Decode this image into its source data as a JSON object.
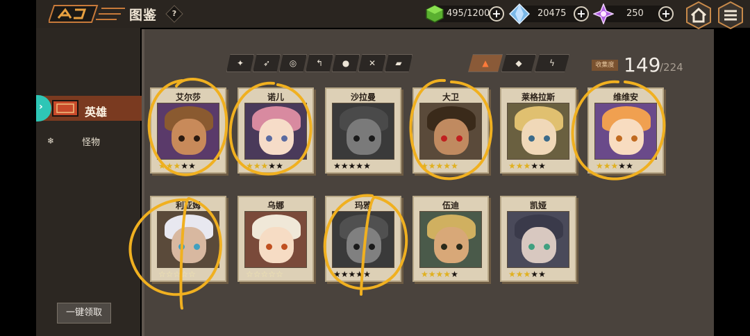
{
  "header": {
    "title": "图鉴",
    "help_label": "?",
    "resources": [
      {
        "name": "energy",
        "icon": "green-cube-icon",
        "value": "495/1200"
      },
      {
        "name": "crystal",
        "icon": "blue-crystal-icon",
        "value": "20475"
      },
      {
        "name": "gem",
        "icon": "purple-gem-icon",
        "value": "250"
      }
    ],
    "plus_label": "+"
  },
  "sidebar": {
    "tabs": [
      {
        "label": "英雄",
        "active": true
      },
      {
        "label": "怪物",
        "active": false
      }
    ],
    "claim_all_label": "一键领取"
  },
  "filters": {
    "classes": [
      "sword-icon",
      "spear-icon",
      "eye-target-icon",
      "scythe-icon",
      "orb-icon",
      "crossbow-icon",
      "hammer-icon"
    ],
    "elements": [
      "fire-icon",
      "leaf-icon",
      "lightning-icon"
    ]
  },
  "collection": {
    "label": "收集度",
    "count": "149",
    "total": "/224"
  },
  "heroes": [
    {
      "name": "艾尔莎",
      "stars": [
        1,
        1,
        1,
        0,
        0
      ],
      "owned": true,
      "colors": {
        "bg": "#5a3a6a",
        "hair": "#8a5a30",
        "face": "#c88a5a",
        "eye": "#2a1a10"
      }
    },
    {
      "name": "诺儿",
      "stars": [
        1,
        1,
        1,
        0,
        0
      ],
      "owned": true,
      "colors": {
        "bg": "#4a3a5a",
        "hair": "#d88aa0",
        "face": "#f6dcc8",
        "eye": "#5a6aa0"
      }
    },
    {
      "name": "沙拉曼",
      "stars": [
        0,
        0,
        0,
        0,
        0
      ],
      "owned": false,
      "colors": {
        "bg": "#3a3a3a",
        "hair": "#4a4a4a",
        "face": "#7a7a7a",
        "eye": "#1a1a1a"
      }
    },
    {
      "name": "大卫",
      "stars": [
        1,
        1,
        1,
        1,
        1
      ],
      "owned": true,
      "colors": {
        "bg": "#5a4a3a",
        "hair": "#3a2a1a",
        "face": "#c08a60",
        "eye": "#c02020"
      }
    },
    {
      "name": "莱格拉斯",
      "stars": [
        1,
        1,
        1,
        0,
        0
      ],
      "owned": true,
      "colors": {
        "bg": "#6a6040",
        "hair": "#e0c070",
        "face": "#f0d8b8",
        "eye": "#3a6a8a"
      }
    },
    {
      "name": "维维安",
      "stars": [
        1,
        1,
        1,
        0,
        0
      ],
      "owned": true,
      "colors": {
        "bg": "#6a4a8a",
        "hair": "#f0a050",
        "face": "#f8dcc0",
        "eye": "#c06a20"
      }
    },
    {
      "name": "利亚姆",
      "stars": [
        2,
        2,
        2,
        2,
        2
      ],
      "owned": true,
      "colors": {
        "bg": "#5a4a3a",
        "hair": "#e8e8f0",
        "face": "#d8b8a0",
        "eye": "#40a0c0"
      }
    },
    {
      "name": "乌娜",
      "stars": [
        2,
        2,
        2,
        2,
        2
      ],
      "owned": true,
      "colors": {
        "bg": "#7a4a3a",
        "hair": "#f0e8d8",
        "face": "#f6dcc4",
        "eye": "#c05020"
      }
    },
    {
      "name": "玛雅",
      "stars": [
        0,
        0,
        0,
        0,
        0
      ],
      "owned": false,
      "colors": {
        "bg": "#3a3a3a",
        "hair": "#505050",
        "face": "#808080",
        "eye": "#1a1a1a"
      }
    },
    {
      "name": "伍迪",
      "stars": [
        1,
        1,
        1,
        1,
        0
      ],
      "owned": true,
      "colors": {
        "bg": "#4a5a4a",
        "hair": "#d0b060",
        "face": "#d8a878",
        "eye": "#2a2a1a"
      }
    },
    {
      "name": "凯娅",
      "stars": [
        1,
        1,
        1,
        0,
        0
      ],
      "owned": true,
      "colors": {
        "bg": "#4a4a5a",
        "hair": "#3a3a4a",
        "face": "#d8c8c0",
        "eye": "#40a080"
      }
    }
  ]
}
